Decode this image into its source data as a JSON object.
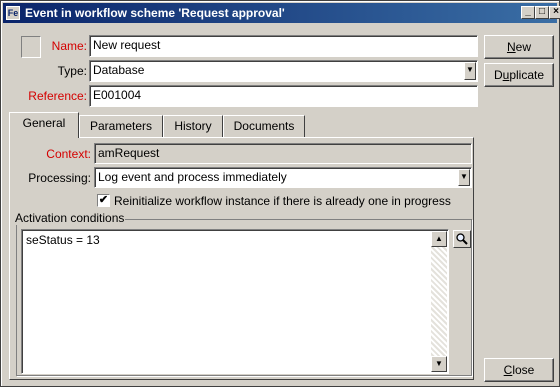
{
  "window": {
    "title": "Event in workflow scheme 'Request approval'",
    "title_icon_glyph": "Fe",
    "controls": {
      "minimize": "_",
      "maximize": "□",
      "close": "×"
    }
  },
  "form": {
    "name_label": "Name:",
    "name_value": "New request",
    "type_label": "Type:",
    "type_value": "Database",
    "reference_label": "Reference:",
    "reference_value": "E001004"
  },
  "buttons": {
    "new_prefix": "",
    "new_underline": "N",
    "new_suffix": "ew",
    "duplicate_prefix": "D",
    "duplicate_underline": "u",
    "duplicate_suffix": "plicate",
    "close_prefix": "",
    "close_underline": "C",
    "close_suffix": "lose"
  },
  "tabs": [
    {
      "label": "General"
    },
    {
      "label": "Parameters"
    },
    {
      "label": "History"
    },
    {
      "label": "Documents"
    }
  ],
  "general": {
    "context_label": "Context:",
    "context_value": "amRequest",
    "processing_label": "Processing:",
    "processing_value": "Log event and process immediately",
    "reinit_label": "Reinitialize workflow instance if there is already one in progress",
    "reinit_checked": true,
    "activation_title": "Activation conditions",
    "activation_text": "seStatus = 13"
  },
  "colors": {
    "required_label": "#d40000",
    "title_start": "#0a246a",
    "title_end": "#3a6ea5"
  }
}
